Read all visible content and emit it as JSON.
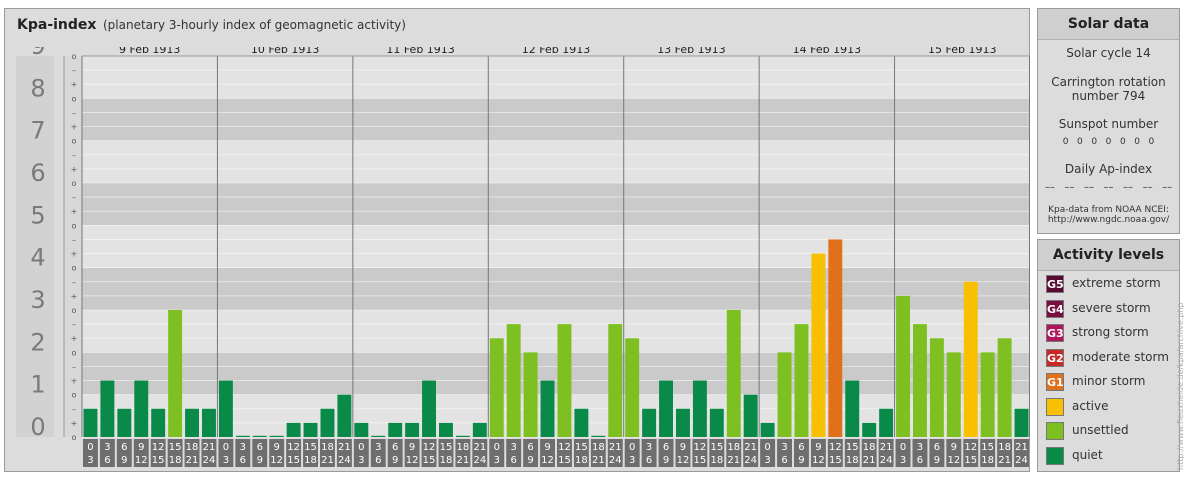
{
  "header": {
    "title": "Kpa-index",
    "subtitle": "(planetary 3-hourly index of geomagnetic activity)"
  },
  "chart_data": {
    "type": "bar",
    "title": "Kpa-index",
    "subtitle": "(planetary 3-hourly index of geomagnetic activity)",
    "ylim": [
      0,
      9
    ],
    "y_ticks": [
      "0",
      "1",
      "2",
      "3",
      "4",
      "5",
      "6",
      "7",
      "8",
      "9"
    ],
    "minor_tick_labels": [
      "o",
      "+",
      "–"
    ],
    "days": [
      "9 Feb 1913",
      "10 Feb 1913",
      "11 Feb 1913",
      "12 Feb 1913",
      "13 Feb 1913",
      "14 Feb 1913",
      "15 Feb 1913"
    ],
    "interval_start": [
      "0",
      "3",
      "6",
      "9",
      "12",
      "15",
      "18",
      "21"
    ],
    "interval_end": [
      "3",
      "6",
      "9",
      "12",
      "15",
      "18",
      "21",
      "24"
    ],
    "values": [
      [
        0.667,
        1.333,
        0.667,
        1.333,
        0.667,
        3.0,
        0.667,
        0.667
      ],
      [
        1.333,
        0.0,
        0.0,
        0.0,
        0.333,
        0.333,
        0.667,
        1.0
      ],
      [
        0.333,
        0.0,
        0.333,
        0.333,
        1.333,
        0.333,
        0.0,
        0.333
      ],
      [
        2.333,
        2.667,
        2.0,
        1.333,
        2.667,
        0.667,
        0.0,
        2.667
      ],
      [
        2.333,
        0.667,
        1.333,
        0.667,
        1.333,
        0.667,
        3.0,
        1.0
      ],
      [
        0.333,
        2.0,
        2.667,
        4.333,
        4.667,
        1.333,
        0.333,
        0.667
      ],
      [
        3.333,
        2.667,
        2.333,
        2.0,
        3.667,
        2.0,
        2.333,
        0.667
      ]
    ]
  },
  "solar": {
    "heading": "Solar data",
    "cycle": "Solar cycle 14",
    "carrington_line1": "Carrington rotation",
    "carrington_line2": "number 794",
    "sunspot_label": "Sunspot number",
    "sunspot_values": "0   0   0   0   0   0   0",
    "ap_label": "Daily Ap-index",
    "ap_values": "––   ––   ––   ––   ––   ––   ––",
    "source_line1": "Kpa-data from NOAA NCEI:",
    "source_line2": "http://www.ngdc.noaa.gov/"
  },
  "levels": {
    "heading": "Activity levels",
    "items": [
      {
        "code": "G5",
        "label": "extreme storm",
        "color": "#5a0a2e"
      },
      {
        "code": "G4",
        "label": "severe storm",
        "color": "#7a0f3f"
      },
      {
        "code": "G3",
        "label": "strong storm",
        "color": "#b0145a"
      },
      {
        "code": "G2",
        "label": "moderate storm",
        "color": "#c62828"
      },
      {
        "code": "G1",
        "label": "minor storm",
        "color": "#e0701a"
      },
      {
        "code": "",
        "label": "active",
        "color": "#f8c000"
      },
      {
        "code": "",
        "label": "unsettled",
        "color": "#7ec021"
      },
      {
        "code": "",
        "label": "quiet",
        "color": "#0a8a48"
      }
    ]
  },
  "watermark": "http://www.fleuxheide.de/kpa/archive.php"
}
